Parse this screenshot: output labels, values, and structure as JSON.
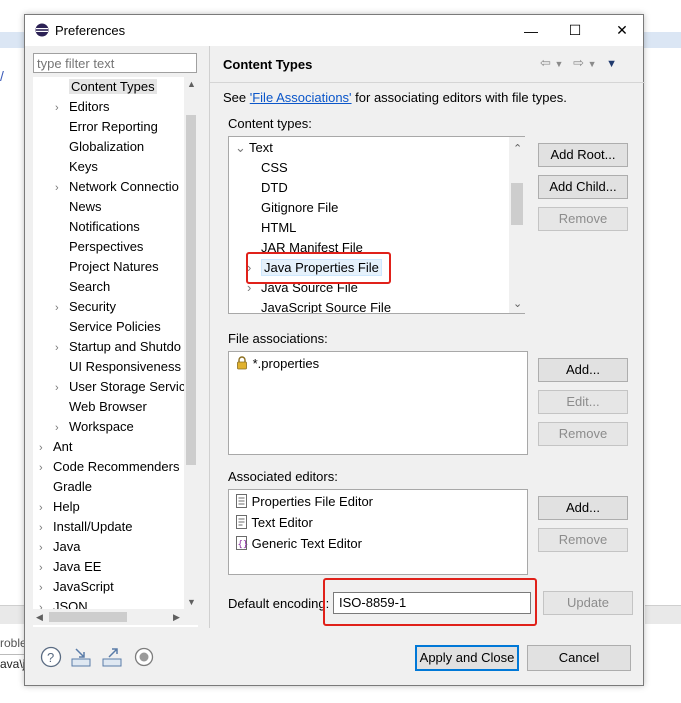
{
  "dialog": {
    "title": "Preferences",
    "window_buttons": {
      "minimize": "—",
      "maximize": "☐",
      "close": "✕"
    }
  },
  "filter": {
    "placeholder": "type filter text"
  },
  "tree": {
    "items": [
      {
        "label": "Content Types",
        "indent": 1,
        "arrow": "",
        "selected": true
      },
      {
        "label": "Editors",
        "indent": 1,
        "arrow": "›"
      },
      {
        "label": "Error Reporting",
        "indent": 1,
        "arrow": ""
      },
      {
        "label": "Globalization",
        "indent": 1,
        "arrow": ""
      },
      {
        "label": "Keys",
        "indent": 1,
        "arrow": ""
      },
      {
        "label": "Network Connectio",
        "indent": 1,
        "arrow": "›"
      },
      {
        "label": "News",
        "indent": 1,
        "arrow": ""
      },
      {
        "label": "Notifications",
        "indent": 1,
        "arrow": ""
      },
      {
        "label": "Perspectives",
        "indent": 1,
        "arrow": ""
      },
      {
        "label": "Project Natures",
        "indent": 1,
        "arrow": ""
      },
      {
        "label": "Search",
        "indent": 1,
        "arrow": ""
      },
      {
        "label": "Security",
        "indent": 1,
        "arrow": "›"
      },
      {
        "label": "Service Policies",
        "indent": 1,
        "arrow": ""
      },
      {
        "label": "Startup and Shutdo",
        "indent": 1,
        "arrow": "›"
      },
      {
        "label": "UI Responsiveness",
        "indent": 1,
        "arrow": ""
      },
      {
        "label": "User Storage Servic",
        "indent": 1,
        "arrow": "›"
      },
      {
        "label": "Web Browser",
        "indent": 1,
        "arrow": ""
      },
      {
        "label": "Workspace",
        "indent": 1,
        "arrow": "›"
      },
      {
        "label": "Ant",
        "indent": 0,
        "arrow": "›"
      },
      {
        "label": "Code Recommenders",
        "indent": 0,
        "arrow": "›"
      },
      {
        "label": "Gradle",
        "indent": 0,
        "arrow": ""
      },
      {
        "label": "Help",
        "indent": 0,
        "arrow": "›"
      },
      {
        "label": "Install/Update",
        "indent": 0,
        "arrow": "›"
      },
      {
        "label": "Java",
        "indent": 0,
        "arrow": "›"
      },
      {
        "label": "Java EE",
        "indent": 0,
        "arrow": "›"
      },
      {
        "label": "JavaScript",
        "indent": 0,
        "arrow": "›"
      },
      {
        "label": "JSON",
        "indent": 0,
        "arrow": "›"
      }
    ]
  },
  "page": {
    "title": "Content Types",
    "see_prefix": "See ",
    "see_link": "'File Associations'",
    "see_suffix": " for associating editors with file types.",
    "content_types_label": "Content types:",
    "content_types": [
      {
        "label": "Text",
        "arrow": "⌄",
        "indent": 0
      },
      {
        "label": "CSS",
        "arrow": "",
        "indent": 1
      },
      {
        "label": "DTD",
        "arrow": "",
        "indent": 1
      },
      {
        "label": "Gitignore File",
        "arrow": "",
        "indent": 1
      },
      {
        "label": "HTML",
        "arrow": "",
        "indent": 1
      },
      {
        "label": "JAR Manifest File",
        "arrow": "",
        "indent": 1
      },
      {
        "label": "Java Properties File",
        "arrow": "›",
        "indent": 1,
        "selected": true
      },
      {
        "label": "Java Source File",
        "arrow": "›",
        "indent": 1
      },
      {
        "label": "JavaScript Source File",
        "arrow": "",
        "indent": 1
      }
    ],
    "buttons_ct": {
      "add_root": "Add Root...",
      "add_child": "Add Child...",
      "remove": "Remove"
    },
    "file_assoc_label": "File associations:",
    "file_assoc": [
      "*.properties"
    ],
    "buttons_fa": {
      "add": "Add...",
      "edit": "Edit...",
      "remove": "Remove"
    },
    "assoc_editors_label": "Associated editors:",
    "assoc_editors": [
      "Properties File Editor",
      "Text Editor",
      "Generic Text Editor"
    ],
    "buttons_ae": {
      "add": "Add...",
      "remove": "Remove"
    },
    "encoding_label": "Default encoding:",
    "encoding_value": "ISO-8859-1",
    "update": "Update"
  },
  "footer": {
    "apply_close": "Apply and Close",
    "cancel": "Cancel"
  },
  "background": {
    "text1": "roble",
    "text2": "ava\\j"
  },
  "colors": {
    "accent": "#0078d7",
    "highlight": "#e0211a",
    "link": "#0b56c9"
  }
}
